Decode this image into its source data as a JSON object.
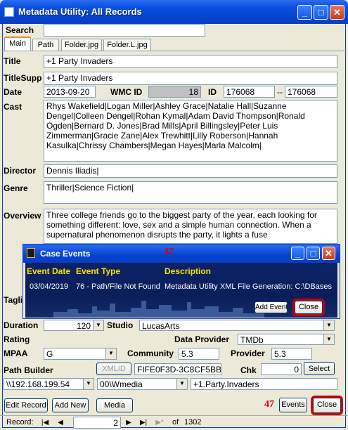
{
  "window": {
    "title": "Metadata Utility: All Records",
    "minimize": "_",
    "maximize": "□",
    "close": "✕"
  },
  "search": {
    "label": "Search",
    "value": ""
  },
  "tabs": [
    {
      "label": "Main"
    },
    {
      "label": "Path"
    },
    {
      "label": "Folder.jpg"
    },
    {
      "label": "Folder.L.jpg"
    }
  ],
  "fields": {
    "title_label": "Title",
    "title_value": "+1 Party Invaders",
    "titlesupp_label": "TitleSupp",
    "titlesupp_value": "+1 Party Invaders",
    "date_label": "Date",
    "date_value": "2013-09-20",
    "wmcid_label": "WMC ID",
    "wmcid_value": "18",
    "id_label": "ID",
    "id_value": "176068",
    "id_sep": "--",
    "id_value2": "176068",
    "cast_label": "Cast",
    "cast_value": "Rhys Wakefield|Logan Miller|Ashley Grace|Natalie Hall|Suzanne Dengel|Colleen Dengel|Rohan Kymal|Adam David Thompson|Ronald Ogden|Bernard D. Jones|Brad Mills|April Billingsley|Peter Luis Zimmerman|Gracie Zane|Alex Trewhitt|Lilly Roberson|Hannah Kasulka|Chrissy Chambers|Megan Hayes|Marla Malcolm|",
    "director_label": "Director",
    "director_value": "Dennis Iliadis|",
    "genre_label": "Genre",
    "genre_value": "Thriller|Science Fiction|",
    "overview_label": "Overview",
    "overview_value": "Three college friends go to the biggest party of the year, each looking for something different: love, sex and a simple human connection. When a supernatural phenomenon disrupts the party, it lights a fuse",
    "tagline_label": "Tagli",
    "duration_label": "Duration",
    "duration_value": "120",
    "studio_label": "Studio",
    "studio_value": "LucasArts",
    "rating_label": "Rating",
    "dataprovider_label": "Data Provider",
    "dataprovider_value": "TMDb",
    "mpaa_label": "MPAA",
    "mpaa_value": "G",
    "community_label": "Community",
    "community_value": "5.3",
    "provider_label": "Provider",
    "provider_value": "5.3",
    "pathbuilder_label": "Path Builder",
    "xmlid_label": "XMLID",
    "xmlid_value": "FIFE0F3D-3C8CF5BB",
    "chk_label": "Chk",
    "chk_value": "0",
    "select_label": "Select",
    "path_server": "\\\\192.168.199.54",
    "path_share": "00\\Wmedia",
    "path_folder": "+1.Party.Invaders"
  },
  "bottom": {
    "edit_record": "Edit Record",
    "add_new": "Add New",
    "media": "Media",
    "badge": "47",
    "events": "Events",
    "close": "Close"
  },
  "nav": {
    "record_label": "Record:",
    "current": "2",
    "of_label": "of",
    "total": "1302",
    "first": "|◀",
    "prev": "◀",
    "next": "▶",
    "last": "▶|",
    "new": "▶*"
  },
  "popup": {
    "title": "Case Events",
    "badge": "47",
    "headers": {
      "date": "Event Date",
      "type": "Event Type",
      "desc": "Description"
    },
    "rows": [
      {
        "date": "03/04/2019",
        "type": "76 - Path/File Not Found",
        "desc": "Metadata Utility XML File Generation: C:\\DBases"
      }
    ],
    "add_event": "Add Event",
    "close": "Close"
  }
}
